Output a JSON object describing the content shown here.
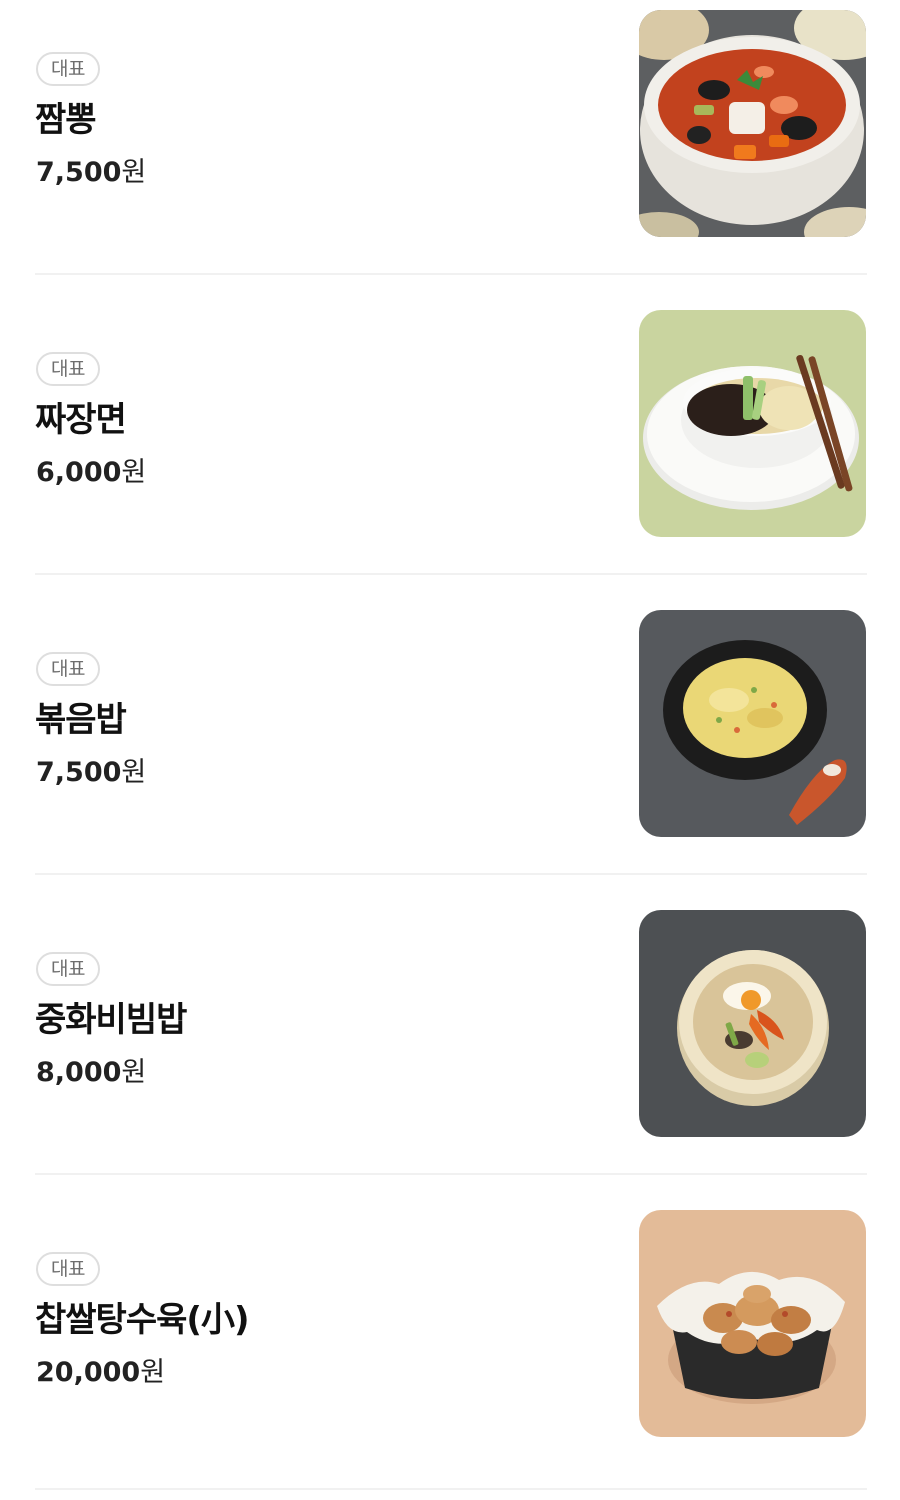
{
  "menu": {
    "items": [
      {
        "badge": "대표",
        "name": "짬뽕",
        "price": "7,500",
        "currency": "원",
        "image": "jjamppong-photo",
        "colors": {
          "bg": "#5d5f61",
          "bowl": "#f1efea",
          "food": "#c2421e"
        }
      },
      {
        "badge": "대표",
        "name": "짜장면",
        "price": "6,000",
        "currency": "원",
        "image": "jajangmyeon-photo",
        "colors": {
          "bg": "#c9d49f",
          "bowl": "#fafaf8",
          "food": "#2b1f1a"
        }
      },
      {
        "badge": "대표",
        "name": "볶음밥",
        "price": "7,500",
        "currency": "원",
        "image": "fried-rice-photo",
        "colors": {
          "bg": "#56595d",
          "bowl": "#1c1c1c",
          "food": "#ead776"
        }
      },
      {
        "badge": "대표",
        "name": "중화비빔밥",
        "price": "8,000",
        "currency": "원",
        "image": "chinese-bibimbap-photo",
        "colors": {
          "bg": "#4d5053",
          "bowl": "#efe4c7",
          "food": "#d9c499"
        }
      },
      {
        "badge": "대표",
        "name": "찹쌀탕수육(小)",
        "price": "20,000",
        "currency": "원",
        "image": "tangsuyuk-photo",
        "colors": {
          "bg": "#e3bb98",
          "bowl": "#2a2a2a",
          "food": "#c98a4f"
        }
      }
    ]
  }
}
